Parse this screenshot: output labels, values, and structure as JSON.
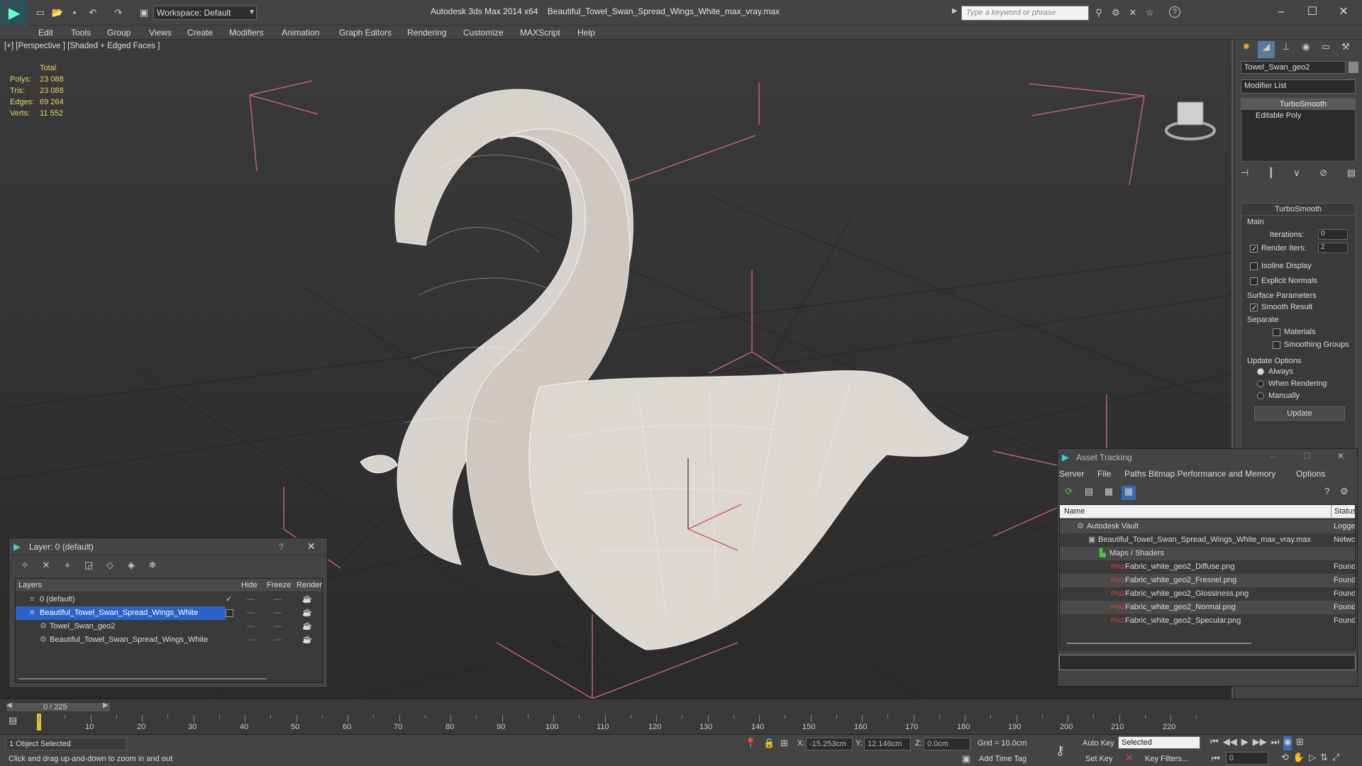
{
  "titlebar": {
    "workspace": "Workspace: Default",
    "app": "Autodesk 3ds Max  2014 x64",
    "file": "Beautiful_Towel_Swan_Spread_Wings_White_max_vray.max",
    "search_placeholder": "Type a keyword or phrase"
  },
  "menu": [
    "Edit",
    "Tools",
    "Group",
    "Views",
    "Create",
    "Modifiers",
    "Animation",
    "Graph Editors",
    "Rendering",
    "Customize",
    "MAXScript",
    "Help"
  ],
  "viewport": {
    "label": "[+] [Perspective ] [Shaded + Edged Faces ]",
    "stats": {
      "total": "Total",
      "rows": [
        [
          "Polys:",
          "23 088"
        ],
        [
          "Tris:",
          "23 088"
        ],
        [
          "Edges:",
          "69 264"
        ],
        [
          "Verts:",
          "11 552"
        ]
      ]
    }
  },
  "cmd": {
    "object_name": "Towel_Swan_geo2",
    "modifier_list": "Modifier List",
    "stack": [
      "TurboSmooth",
      "Editable Poly"
    ],
    "rollout_title": "TurboSmooth",
    "main": "Main",
    "iterations_label": "Iterations:",
    "iterations": "0",
    "render_iters_label": "Render Iters:",
    "render_iters": "2",
    "isoline": "Isoline Display",
    "explicit": "Explicit Normals",
    "surface": "Surface Parameters",
    "smooth": "Smooth Result",
    "separate": "Separate",
    "materials": "Materials",
    "smoothing_groups": "Smoothing Groups",
    "update_options": "Update Options",
    "always": "Always",
    "when_rendering": "When Rendering",
    "manually": "Manually",
    "update": "Update"
  },
  "layers": {
    "title": "Layer: 0 (default)",
    "help": "?",
    "cols": [
      "Layers",
      "Hide",
      "Freeze",
      "Render"
    ],
    "rows": [
      "0 (default)",
      "Beautiful_Towel_Swan_Spread_Wings_White",
      "Towel_Swan_geo2",
      "Beautiful_Towel_Swan_Spread_Wings_White"
    ]
  },
  "assets": {
    "title": "Asset Tracking",
    "menus": [
      "Server",
      "File",
      "Paths",
      "Bitmap Performance and Memory",
      "Options"
    ],
    "cols": [
      "Name",
      "Status"
    ],
    "rows": [
      [
        "Autodesk Vault",
        "Logge"
      ],
      [
        "Beautiful_Towel_Swan_Spread_Wings_White_max_vray.max",
        "Netwo"
      ],
      [
        "Maps / Shaders",
        ""
      ],
      [
        "Fabric_white_geo2_Diffuse.png",
        "Found"
      ],
      [
        "Fabric_white_geo2_Fresnel.png",
        "Found"
      ],
      [
        "Fabric_white_geo2_Glossiness.png",
        "Found"
      ],
      [
        "Fabric_white_geo2_Normal.png",
        "Found"
      ],
      [
        "Fabric_white_geo2_Specular.png",
        "Found"
      ]
    ]
  },
  "timeline": {
    "frame": "0 / 225",
    "ticks": [
      "10",
      "20",
      "30",
      "40",
      "50",
      "60",
      "70",
      "80",
      "90",
      "100",
      "110",
      "120",
      "130",
      "140",
      "150",
      "160",
      "170",
      "180",
      "190",
      "200",
      "210",
      "220"
    ]
  },
  "status": {
    "selected": "1 Object Selected",
    "hint": "Click and drag up-and-down to zoom in and out",
    "x_label": "X:",
    "x": "-15.253cm",
    "y_label": "Y:",
    "y": "12.146cm",
    "z_label": "Z:",
    "z": "0.0cm",
    "grid": "Grid = 10.0cm",
    "auto_key": "Auto Key",
    "set_key": "Set Key",
    "selected_dd": "Selected",
    "key_filters": "Key Filters...",
    "add_time_tag": "Add Time Tag",
    "frame_field": "0"
  }
}
